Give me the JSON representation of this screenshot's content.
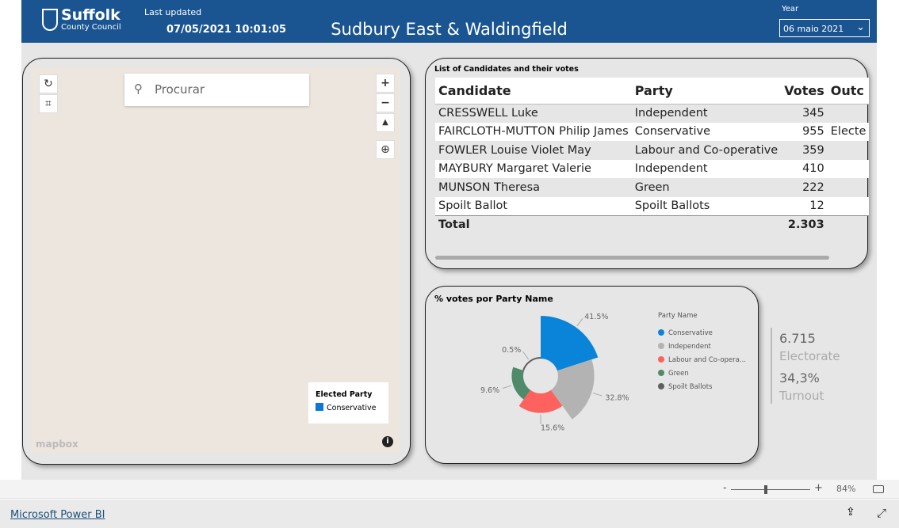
{
  "header": {
    "logo_line1": "Suffolk",
    "logo_line2": "County Council",
    "last_updated_label": "Last updated",
    "last_updated_value": "07/05/2021 10:01:05",
    "title": "Sudbury East & Waldingfield",
    "year_label": "Year",
    "year_value": "06 maio 2021"
  },
  "map": {
    "search_placeholder": "Procurar",
    "legend_title": "Elected Party",
    "legend_item": "Conservative",
    "legend_color": "#0a78d4",
    "attribution": "mapbox"
  },
  "table": {
    "caption": "List of Candidates and their votes",
    "columns": [
      "Candidate",
      "Party",
      "Votes",
      "Outc"
    ],
    "rows": [
      [
        "CRESSWELL Luke",
        "Independent",
        "345",
        ""
      ],
      [
        "FAIRCLOTH-MUTTON Philip James",
        "Conservative",
        "955",
        "Electe"
      ],
      [
        "FOWLER Louise Violet May",
        "Labour and Co-operative",
        "359",
        ""
      ],
      [
        "MAYBURY Margaret Valerie",
        "Independent",
        "410",
        ""
      ],
      [
        "MUNSON Theresa",
        "Green",
        "222",
        ""
      ],
      [
        "Spoilt Ballot",
        "Spoilt Ballots",
        "12",
        ""
      ]
    ],
    "total_label": "Total",
    "total_votes": "2.303"
  },
  "chart_data": {
    "type": "pie",
    "variant": "rose-donut",
    "title": "% votes por Party Name",
    "legend_title": "Party Name",
    "legend_placement": "right",
    "categories": [
      "Conservative",
      "Independent",
      "Labour and Co-opera...",
      "Green",
      "Spoilt Ballots"
    ],
    "values": [
      41.5,
      32.8,
      15.6,
      9.6,
      0.5
    ],
    "labels": [
      "41.5%",
      "32.8%",
      "15.6%",
      "9.6%",
      "0.5%"
    ],
    "colors": [
      "#0a84d8",
      "#b3b3b3",
      "#fd625e",
      "#4f8a6a",
      "#5f5f5f"
    ]
  },
  "kpis": {
    "electorate_value": "6.715",
    "electorate_label": "Electorate",
    "turnout_value": "34,3%",
    "turnout_label": "Turnout"
  },
  "footer": {
    "zoom_minus": "-",
    "zoom_plus": "+",
    "zoom_level": "84%",
    "zoom_fraction": 0.84,
    "brand_link": "Microsoft Power BI"
  }
}
